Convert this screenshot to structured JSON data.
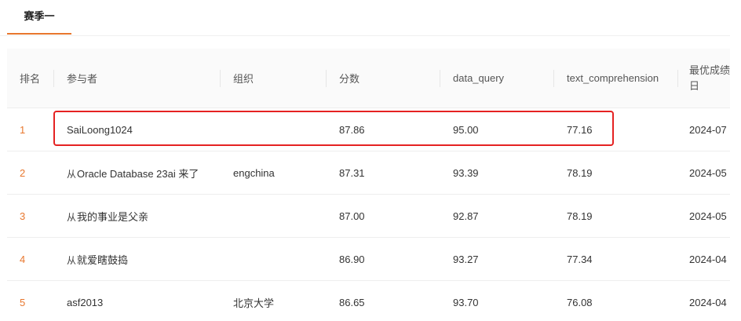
{
  "tabs": [
    {
      "label": "赛季一"
    }
  ],
  "table": {
    "headers": {
      "rank": "排名",
      "participant": "参与者",
      "organization": "组织",
      "score": "分数",
      "data_query": "data_query",
      "text_comprehension": "text_comprehension",
      "best_time_line1": "最优成绩",
      "best_time_line2": "日"
    },
    "rows": [
      {
        "rank": "1",
        "participant": "SaiLoong1024",
        "has_icon": false,
        "organization": "",
        "score": "87.86",
        "data_query": "95.00",
        "text_comprehension": "77.16",
        "date": "2024-07"
      },
      {
        "rank": "2",
        "participant": "Oracle Database 23ai 来了",
        "has_icon": true,
        "organization": "engchina",
        "score": "87.31",
        "data_query": "93.39",
        "text_comprehension": "78.19",
        "date": "2024-05"
      },
      {
        "rank": "3",
        "participant": "我的事业是父亲",
        "has_icon": true,
        "organization": "",
        "score": "87.00",
        "data_query": "92.87",
        "text_comprehension": "78.19",
        "date": "2024-05"
      },
      {
        "rank": "4",
        "participant": "就爱瞎鼓捣",
        "has_icon": true,
        "organization": "",
        "score": "86.90",
        "data_query": "93.27",
        "text_comprehension": "77.34",
        "date": "2024-04"
      },
      {
        "rank": "5",
        "participant": "asf2013",
        "has_icon": false,
        "organization": "北京大学",
        "score": "86.65",
        "data_query": "93.70",
        "text_comprehension": "76.08",
        "date": "2024-04"
      }
    ]
  },
  "icons": {
    "team": "team-icon"
  },
  "colors": {
    "accent": "#e8772e",
    "highlight": "#e52222",
    "header_bg": "#fafafa"
  }
}
